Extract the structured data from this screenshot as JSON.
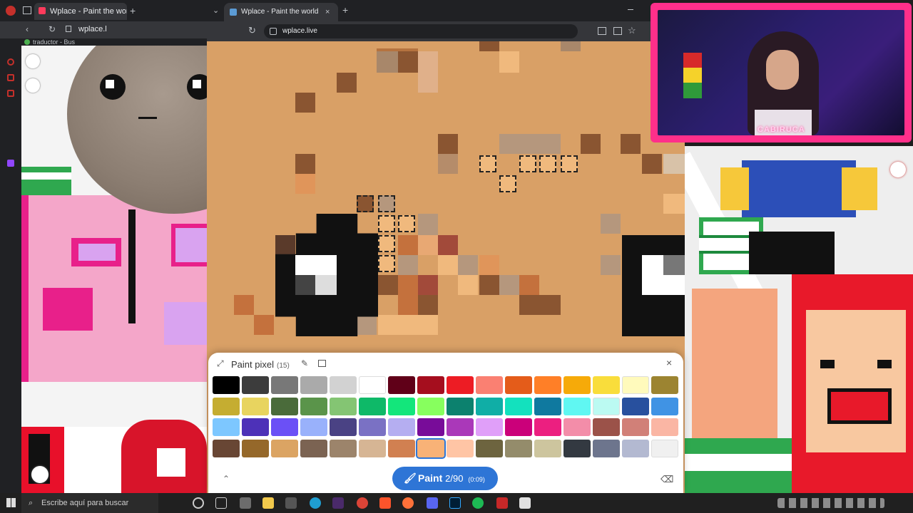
{
  "left_browser": {
    "tab_title": "Wplace - Paint the world",
    "address": "wplace.l",
    "bookmark": "traductor - Bus"
  },
  "main_browser": {
    "tab_title": "Wplace - Paint the world",
    "address": "wplace.live"
  },
  "webcam": {
    "overlay_name": "CABIRUCA"
  },
  "paint_panel": {
    "title": "Paint pixel",
    "count_label": "(15)",
    "palette": [
      "#000000",
      "#3c3c3c",
      "#787878",
      "#aaaaaa",
      "#d2d2d2",
      "#ffffff",
      "#600018",
      "#a50e1e",
      "#ed1c24",
      "#fa8072",
      "#e45c1a",
      "#ff7f27",
      "#f6aa09",
      "#f9dd3b",
      "#fffabc",
      "#9c8431",
      "#c5ad31",
      "#e8d45f",
      "#4a6b3a",
      "#5a944a",
      "#84c573",
      "#0eb968",
      "#13e67b",
      "#87ff5e",
      "#0c816e",
      "#10aea6",
      "#13e1be",
      "#0f799f",
      "#60f7f2",
      "#bbfaf2",
      "#28509e",
      "#4093e4",
      "#7dc7ff",
      "#4d31b8",
      "#6b50f6",
      "#99b1fb",
      "#4a4284",
      "#7a71c4",
      "#b5aef1",
      "#780c99",
      "#aa38b9",
      "#e09ff9",
      "#cb007a",
      "#ec1f80",
      "#f38da9",
      "#9b5249",
      "#d18078",
      "#fab6a4",
      "#684634",
      "#95682a",
      "#dba463",
      "#7b6352",
      "#9c846b",
      "#d6b594",
      "#d18051",
      "#f8b277",
      "#ffc5a5",
      "#6d643f",
      "#948c6b",
      "#cdc59e",
      "#333941",
      "#6d758d",
      "#b3b9d1",
      "#f0f0f0"
    ],
    "selected_color": "#f8b277",
    "paint_label": "Paint",
    "paint_count": "2/90",
    "paint_timer": "(0:09)"
  },
  "taskbar": {
    "search_placeholder": "Escribe aquí para buscar"
  }
}
